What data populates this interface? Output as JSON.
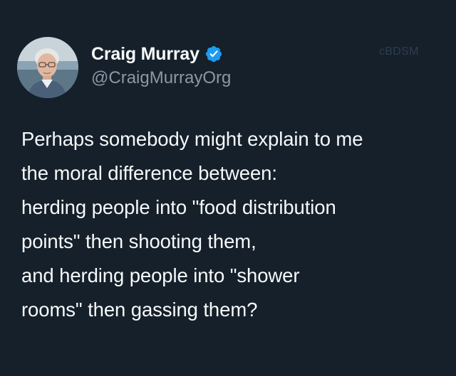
{
  "author": {
    "display_name": "Craig Murray",
    "handle": "@CraigMurrayOrg",
    "verified": true,
    "verified_icon": "verified-badge-icon",
    "verified_color": "#1d9bf0"
  },
  "watermark": "cBDSM",
  "tweet": {
    "lines": [
      "Perhaps somebody might explain to me",
      "the moral difference between:",
      "herding people into \"food distribution",
      "points\" then shooting them,",
      "and herding people into \"shower",
      "rooms\" then gassing them?"
    ]
  },
  "colors": {
    "background": "#15202b",
    "text": "#f7f9f9",
    "secondary_text": "#8b98a5"
  }
}
